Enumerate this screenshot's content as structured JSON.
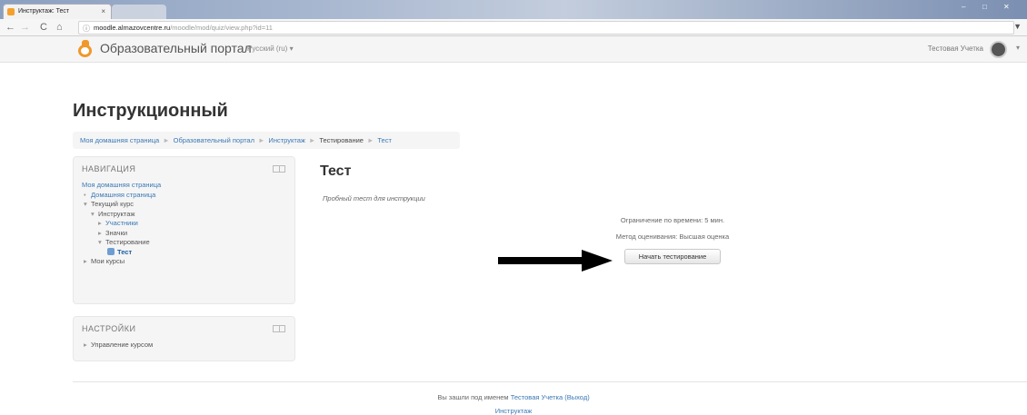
{
  "browser": {
    "tab_title": "Инструктаж: Тест",
    "tab_close": "×",
    "url_host": "moodle.almazovcentre.ru",
    "url_path": "/moodle/mod/quiz/view.php?id=11",
    "nav_back": "←",
    "nav_forward": "→",
    "nav_reload": "C",
    "nav_home": "⌂",
    "info_icon": "ⓘ",
    "menu_icon": "▼",
    "window_minimize": "–",
    "window_maximize": "□",
    "window_close": "✕"
  },
  "navbar": {
    "brand": "Образовательный портал",
    "language": "Русский (ru) ▾",
    "user_name": "Тестовая Учетка",
    "user_caret": "▾"
  },
  "page": {
    "heading": "Инструкционный"
  },
  "breadcrumb": {
    "items": [
      "Моя домашняя страница",
      "Образовательный портал",
      "Инструктаж",
      "Тестирование",
      "Тест"
    ],
    "separator": "►"
  },
  "navigation_block": {
    "title": "НАВИГАЦИЯ",
    "items": {
      "my_home": "Моя домашняя страница",
      "home": "Домашняя страница",
      "current_course": "Текущий курс",
      "course": "Инструктаж",
      "participants": "Участники",
      "badges": "Значки",
      "testing": "Тестирование",
      "test": "Тест",
      "my_courses": "Мои курсы"
    },
    "markers": {
      "bullet": "•",
      "expanded": "▾",
      "collapsed": "▸"
    }
  },
  "settings_block": {
    "title": "НАСТРОЙКИ",
    "items": {
      "course_admin": "Управление курсом"
    }
  },
  "main": {
    "title": "Тест",
    "intro": "Пробный тест для инструкции",
    "time_limit": "Ограничение по времени: 5 мин.",
    "grading_method": "Метод оценивания: Высшая оценка",
    "start_button": "Начать тестирование"
  },
  "footer": {
    "logged_in_prefix": "Вы зашли под именем",
    "user_link": "Тестовая Учетка",
    "logout": "(Выход)",
    "course_link": "Инструктаж"
  }
}
